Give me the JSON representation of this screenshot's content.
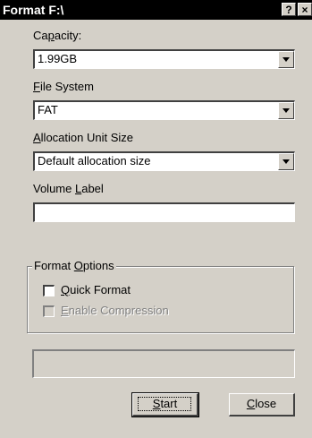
{
  "window": {
    "title": "Format F:\\",
    "help_button": "?",
    "close_button": "×"
  },
  "capacity": {
    "label_pre": "Ca",
    "label_u": "p",
    "label_post": "acity:",
    "value": "1.99GB"
  },
  "file_system": {
    "label_pre": "",
    "label_u": "F",
    "label_post": "ile System",
    "value": "FAT"
  },
  "allocation": {
    "label_pre": "",
    "label_u": "A",
    "label_post": "llocation Unit Size",
    "value": "Default allocation size"
  },
  "volume_label": {
    "label_pre": "Volume ",
    "label_u": "L",
    "label_post": "abel",
    "value": ""
  },
  "format_options": {
    "legend_pre": "Format ",
    "legend_u": "O",
    "legend_post": "ptions",
    "quick_format": {
      "label_pre": "",
      "label_u": "Q",
      "label_post": "uick Format",
      "checked": false
    },
    "enable_compression": {
      "label_pre": "",
      "label_u": "E",
      "label_post": "nable Compression",
      "checked": false,
      "enabled": false
    }
  },
  "progress": {
    "value": 0
  },
  "buttons": {
    "start_pre": "",
    "start_u": "S",
    "start_post": "tart",
    "close_pre": "",
    "close_u": "C",
    "close_post": "lose"
  },
  "colors": {
    "face": "#d4d0c8",
    "titlebar": "#000000",
    "field": "#ffffff",
    "disabled_text": "#808080"
  },
  "icons": {
    "dropdown": "chevron-down-icon",
    "checkbox": "checkbox-icon"
  }
}
